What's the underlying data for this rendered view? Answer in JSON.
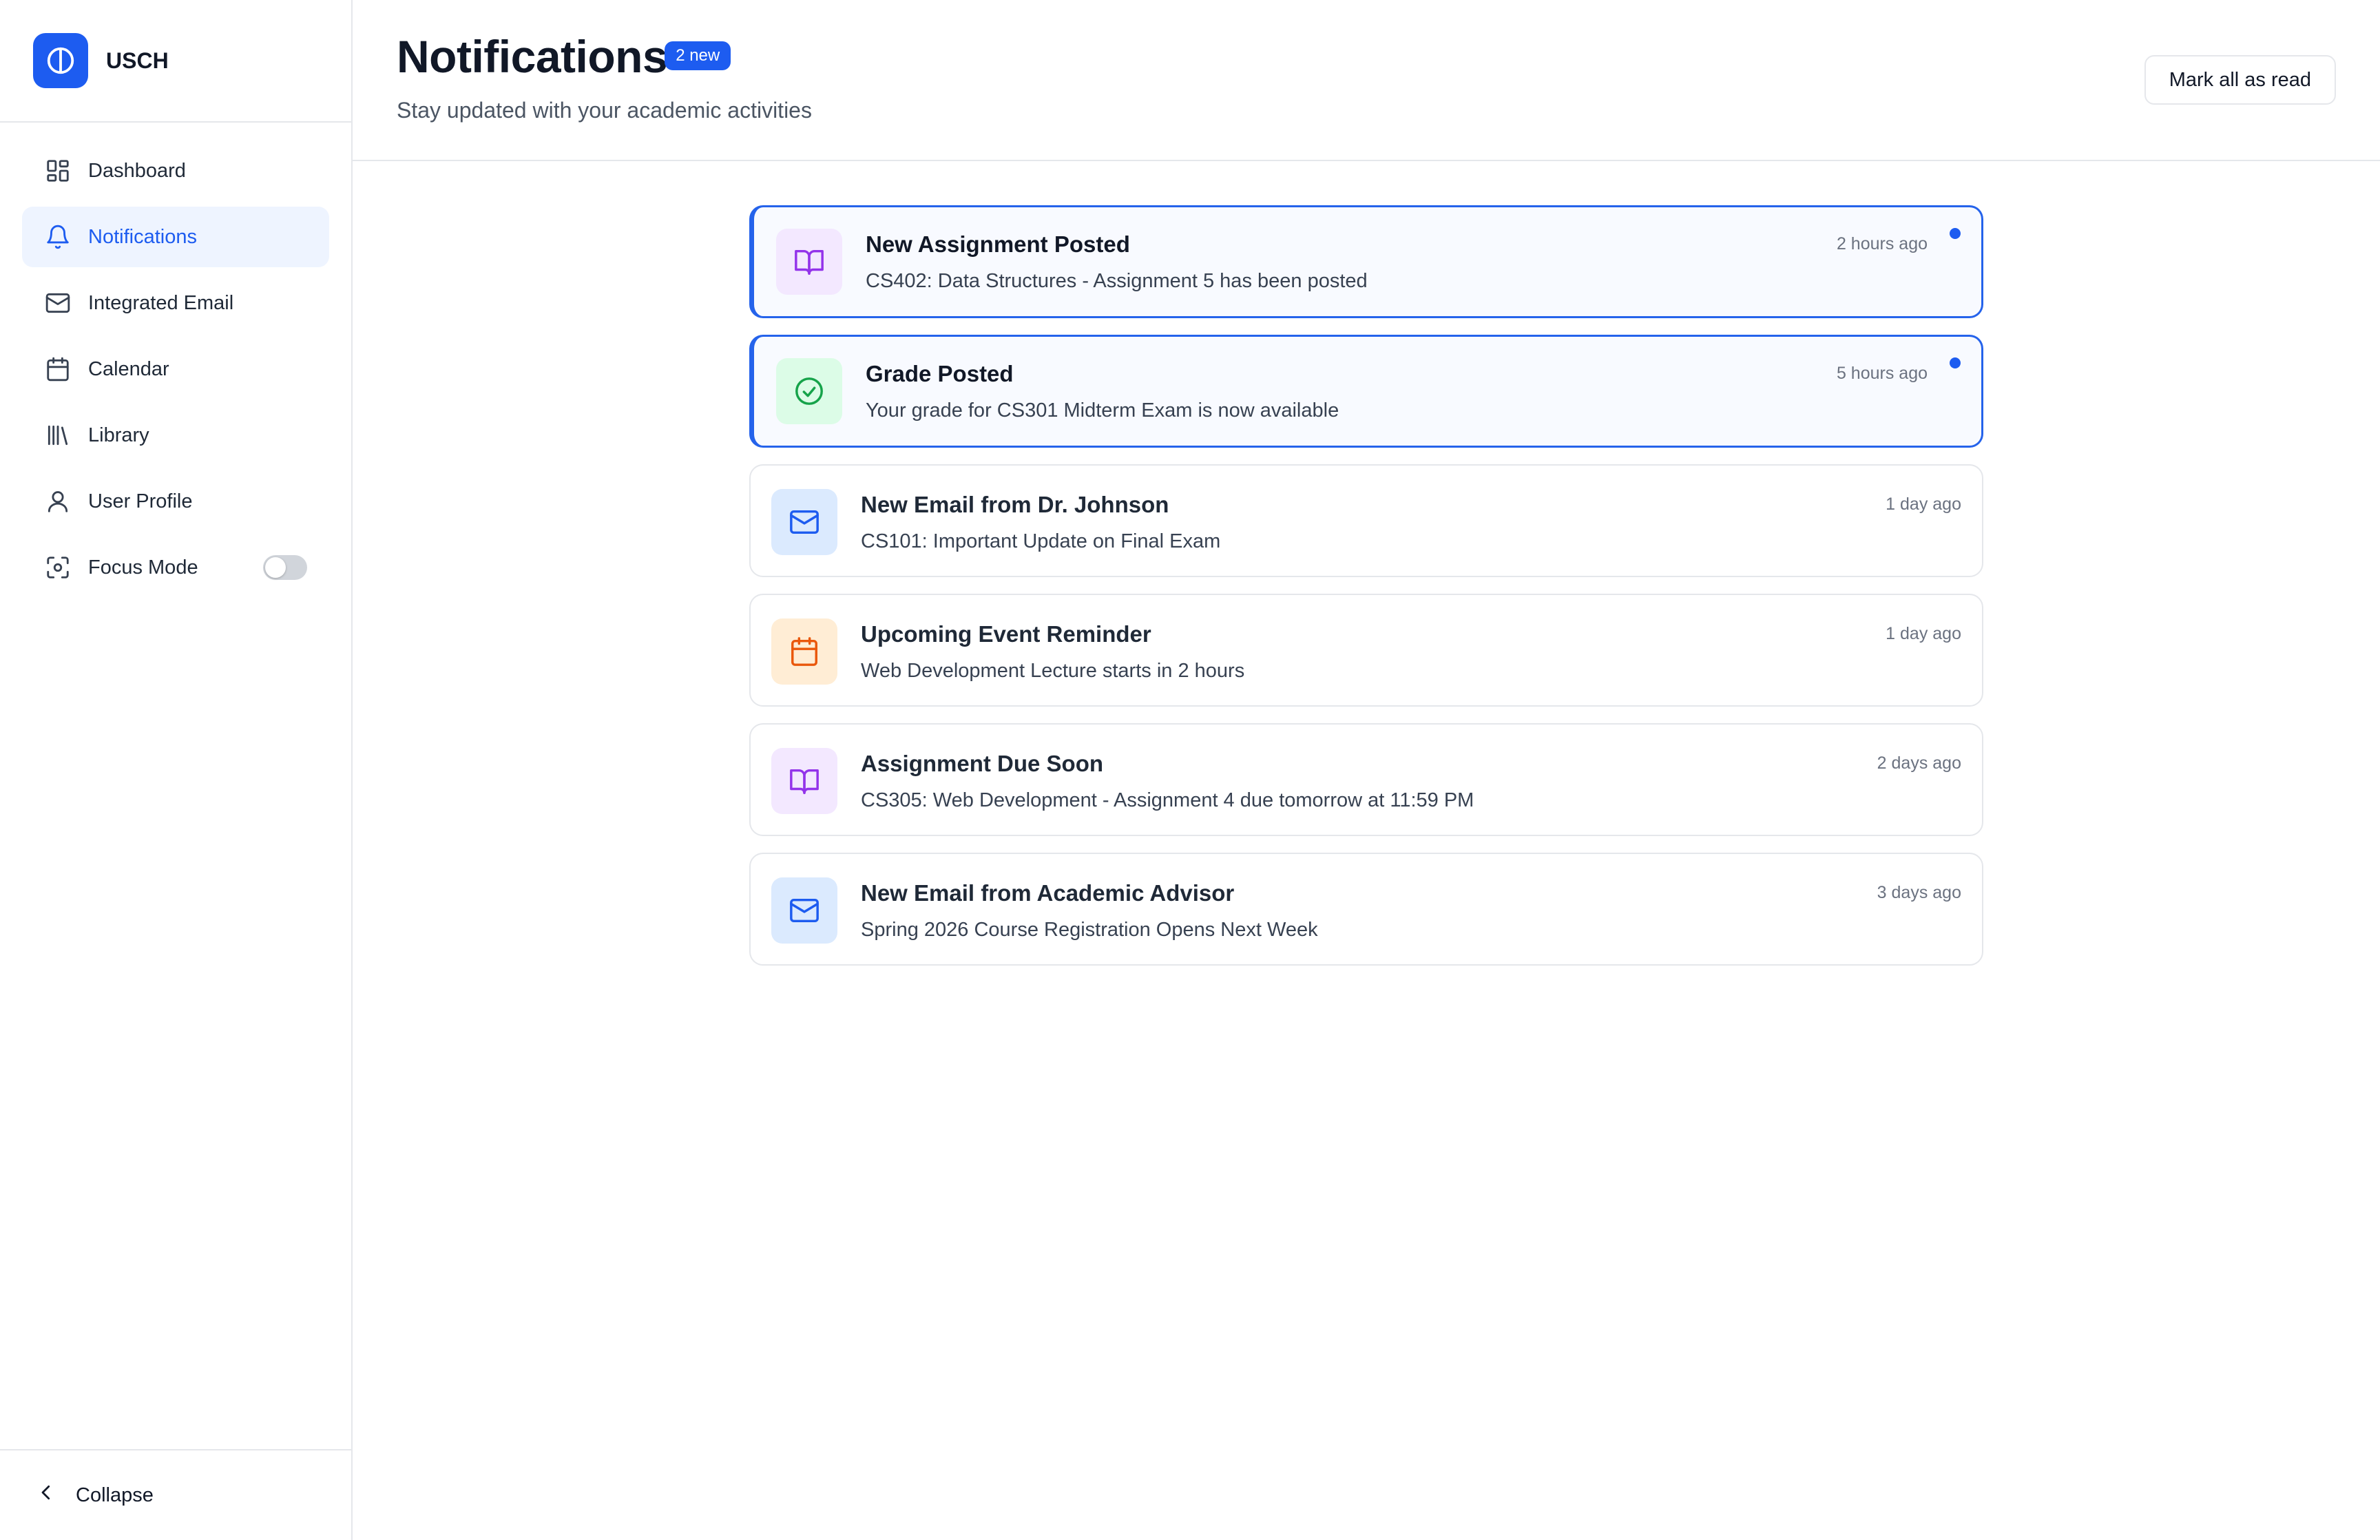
{
  "brand": {
    "name": "USCH",
    "color": "#1d5cf0"
  },
  "sidebar": {
    "items": [
      {
        "label": "Dashboard",
        "icon": "dashboard-grid-icon"
      },
      {
        "label": "Notifications",
        "icon": "bell-icon",
        "active": true
      },
      {
        "label": "Integrated Email",
        "icon": "mail-icon"
      },
      {
        "label": "Calendar",
        "icon": "calendar-icon"
      },
      {
        "label": "Library",
        "icon": "library-icon"
      },
      {
        "label": "User Profile",
        "icon": "user-icon"
      },
      {
        "label": "Focus Mode",
        "icon": "focus-icon",
        "toggle": false
      }
    ],
    "collapse_label": "Collapse"
  },
  "header": {
    "title": "Notifications",
    "badge": "2 new",
    "subtitle": "Stay updated with your academic activities",
    "mark_all_label": "Mark all as read"
  },
  "notifications": [
    {
      "title": "New Assignment Posted",
      "desc": "CS402: Data Structures - Assignment 5 has been posted",
      "time": "2 hours ago",
      "unread": true,
      "icon": "book-open-icon",
      "icon_color": "#9333ea",
      "icon_bg": "#f3e8ff"
    },
    {
      "title": "Grade Posted",
      "desc": "Your grade for CS301 Midterm Exam is now available",
      "time": "5 hours ago",
      "unread": true,
      "icon": "check-circle-icon",
      "icon_color": "#16a34a",
      "icon_bg": "#dcfce7"
    },
    {
      "title": "New Email from Dr. Johnson",
      "desc": "CS101: Important Update on Final Exam",
      "time": "1 day ago",
      "unread": false,
      "icon": "mail-icon",
      "icon_color": "#1d5cf0",
      "icon_bg": "#dbeafe"
    },
    {
      "title": "Upcoming Event Reminder",
      "desc": "Web Development Lecture starts in 2 hours",
      "time": "1 day ago",
      "unread": false,
      "icon": "calendar-icon",
      "icon_color": "#ea580c",
      "icon_bg": "#ffedd5"
    },
    {
      "title": "Assignment Due Soon",
      "desc": "CS305: Web Development - Assignment 4 due tomorrow at 11:59 PM",
      "time": "2 days ago",
      "unread": false,
      "icon": "book-open-icon",
      "icon_color": "#9333ea",
      "icon_bg": "#f3e8ff"
    },
    {
      "title": "New Email from Academic Advisor",
      "desc": "Spring 2026 Course Registration Opens Next Week",
      "time": "3 days ago",
      "unread": false,
      "icon": "mail-icon",
      "icon_color": "#1d5cf0",
      "icon_bg": "#dbeafe"
    }
  ]
}
